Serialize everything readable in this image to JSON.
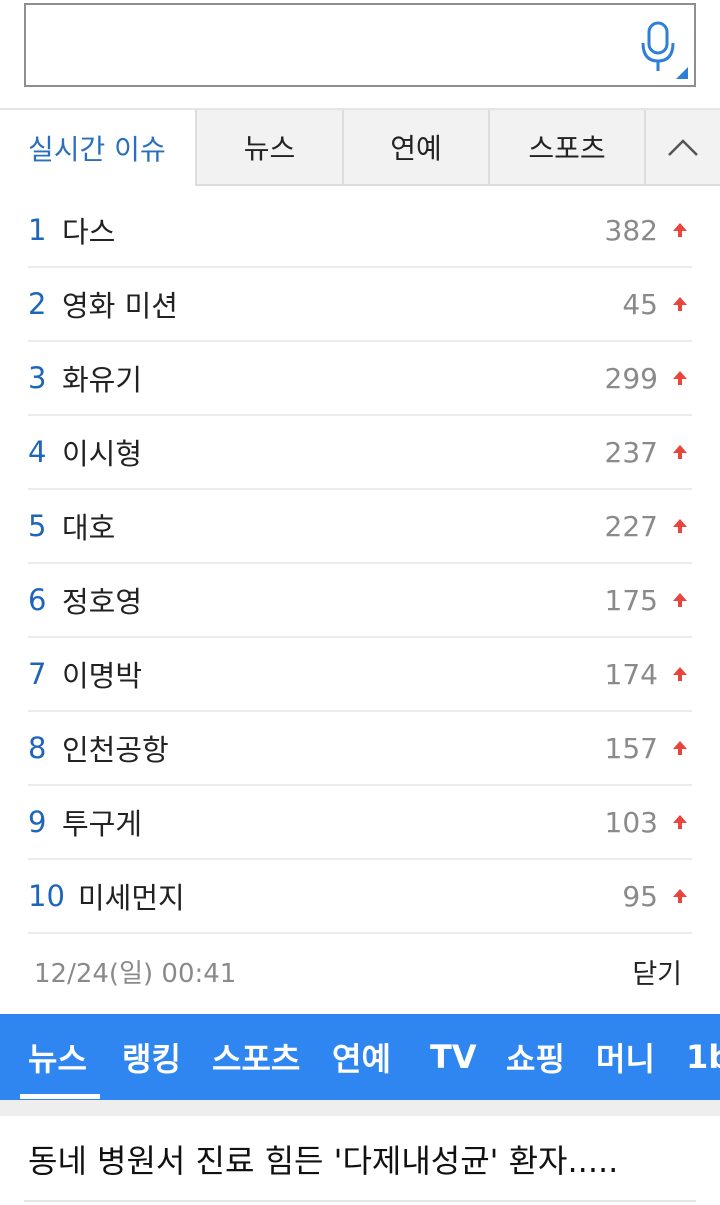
{
  "search": {
    "value": "",
    "placeholder": ""
  },
  "tabs": [
    {
      "label": "실시간 이슈"
    },
    {
      "label": "뉴스"
    },
    {
      "label": "연예"
    },
    {
      "label": "스포츠"
    }
  ],
  "trending": [
    {
      "rank": "1",
      "keyword": "다스",
      "count": "382"
    },
    {
      "rank": "2",
      "keyword": "영화 미션",
      "count": "45"
    },
    {
      "rank": "3",
      "keyword": "화유기",
      "count": "299"
    },
    {
      "rank": "4",
      "keyword": "이시형",
      "count": "237"
    },
    {
      "rank": "5",
      "keyword": "대호",
      "count": "227"
    },
    {
      "rank": "6",
      "keyword": "정호영",
      "count": "175"
    },
    {
      "rank": "7",
      "keyword": "이명박",
      "count": "174"
    },
    {
      "rank": "8",
      "keyword": "인천공항",
      "count": "157"
    },
    {
      "rank": "9",
      "keyword": "투구게",
      "count": "103"
    },
    {
      "rank": "10",
      "keyword": "미세먼지",
      "count": "95"
    }
  ],
  "footer": {
    "timestamp": "12/24(일) 00:41",
    "close_label": "닫기"
  },
  "nav": [
    {
      "label": "뉴스"
    },
    {
      "label": "랭킹"
    },
    {
      "label": "스포츠"
    },
    {
      "label": "연예"
    },
    {
      "label": "TV"
    },
    {
      "label": "쇼핑"
    },
    {
      "label": "머니"
    },
    {
      "label": "1b"
    }
  ],
  "headline": "동네 병원서 진료 힘든 '다제내성균' 환자.....",
  "colors": {
    "accent": "#2f86f0",
    "rank_blue": "#1f66bb",
    "up_arrow": "#e8453c"
  },
  "icons": {
    "mic": "microphone-icon",
    "collapse": "chevron-up-icon",
    "trend": "arrow-up-icon"
  }
}
